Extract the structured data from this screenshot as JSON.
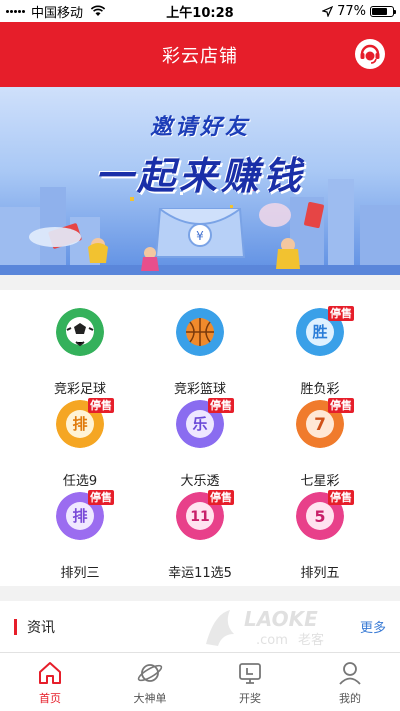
{
  "status_bar": {
    "carrier": "中国移动",
    "time": "上午10:28",
    "battery_text": "77%",
    "battery_level": 0.77
  },
  "header": {
    "title": "彩云店铺",
    "service_icon": "customer-service-icon"
  },
  "banner": {
    "subtitle": "邀请好友",
    "headline": "一起来赚钱"
  },
  "games": [
    {
      "label": "竞彩足球",
      "icon": "soccer-ball-icon",
      "stopped": false,
      "badge": ""
    },
    {
      "label": "竞彩篮球",
      "icon": "basketball-icon",
      "stopped": false,
      "badge": ""
    },
    {
      "label": "胜负彩",
      "icon": "shengfucai-icon",
      "stopped": true,
      "badge": "停售",
      "glyph": "胜"
    },
    {
      "label": "任选9",
      "icon": "renxuan9-icon",
      "stopped": true,
      "badge": "停售",
      "glyph": "排"
    },
    {
      "label": "大乐透",
      "icon": "daletou-icon",
      "stopped": true,
      "badge": "停售",
      "glyph": "乐"
    },
    {
      "label": "七星彩",
      "icon": "qixingcai-icon",
      "stopped": true,
      "badge": "停售",
      "glyph": "7"
    },
    {
      "label": "排列三",
      "icon": "pailie3-icon",
      "stopped": true,
      "badge": "停售",
      "glyph": "排"
    },
    {
      "label": "幸运11选5",
      "icon": "lucky11x5-icon",
      "stopped": true,
      "badge": "停售",
      "glyph": "11"
    },
    {
      "label": "排列五",
      "icon": "pailie5-icon",
      "stopped": true,
      "badge": "停售",
      "glyph": "5"
    }
  ],
  "news": {
    "title": "资讯",
    "more": "更多"
  },
  "watermark": {
    "brand": "LAOKE",
    "domain": ".com",
    "cn": "老客"
  },
  "tabs": [
    {
      "label": "首页",
      "icon": "home-icon",
      "active": true
    },
    {
      "label": "大神单",
      "icon": "planet-icon",
      "active": false
    },
    {
      "label": "开奖",
      "icon": "draw-result-icon",
      "active": false
    },
    {
      "label": "我的",
      "icon": "profile-icon",
      "active": false
    }
  ],
  "colors": {
    "brand_red": "#e61e2a",
    "link_blue": "#3a7bd5"
  }
}
